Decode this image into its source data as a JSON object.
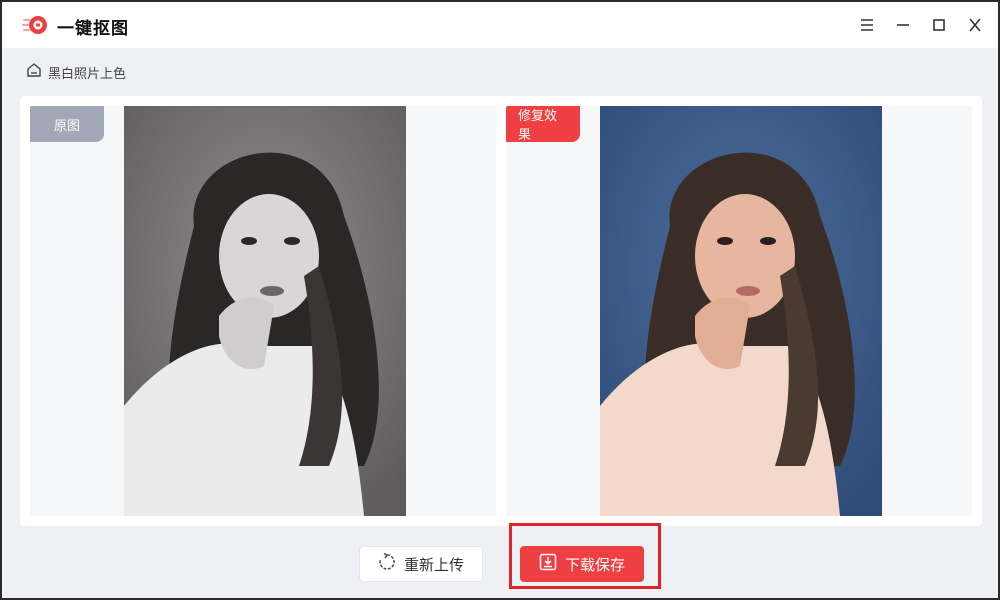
{
  "app": {
    "title": "一键抠图",
    "logo_icon": "logo-icon"
  },
  "window_controls": [
    {
      "name": "menu-icon"
    },
    {
      "name": "minimize-icon"
    },
    {
      "name": "maximize-icon"
    },
    {
      "name": "close-icon"
    }
  ],
  "breadcrumb": {
    "icon": "home-icon",
    "label": "黑白照片上色"
  },
  "panels": {
    "original": {
      "tag": "原图"
    },
    "result": {
      "tag": "修复效果"
    }
  },
  "actions": {
    "reupload_label": "重新上传",
    "download_label": "下载保存"
  },
  "colors": {
    "accent": "#ee4042",
    "tag_gray": "#a3a8b8",
    "bg": "#eef0f3"
  }
}
